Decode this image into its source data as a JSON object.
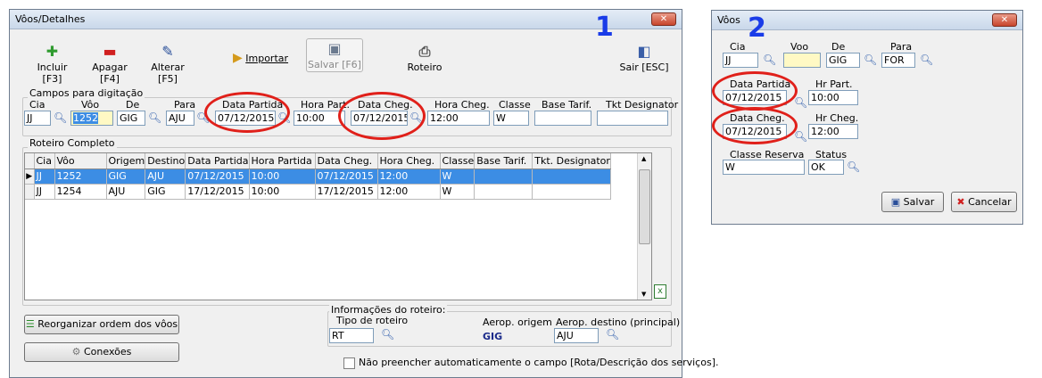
{
  "win1": {
    "title": "Vôos/Detalhes",
    "badge": "1",
    "toolbar": {
      "include": "Incluir [F3]",
      "delete": "Apagar [F4]",
      "edit": "Alterar [F5]",
      "import": "Importar",
      "save": "Salvar [F6]",
      "route": "Roteiro",
      "exit": "Sair [ESC]"
    },
    "fields_group": "Campos para digitação",
    "fields": {
      "cia": {
        "label": "Cia",
        "value": "JJ"
      },
      "voo": {
        "label": "Vôo",
        "value": "1252"
      },
      "de": {
        "label": "De",
        "value": "GIG"
      },
      "para": {
        "label": "Para",
        "value": "AJU"
      },
      "data_partida": {
        "label": "Data Partida",
        "value": "07/12/2015"
      },
      "hora_partida": {
        "label": "Hora Part.",
        "value": "10:00"
      },
      "data_cheg": {
        "label": "Data Cheg.",
        "value": "07/12/2015"
      },
      "hora_cheg": {
        "label": "Hora Cheg.",
        "value": "12:00"
      },
      "classe": {
        "label": "Classe",
        "value": "W"
      },
      "base_tarif": {
        "label": "Base Tarif.",
        "value": ""
      },
      "tkt": {
        "label": "Tkt Designator",
        "value": ""
      }
    },
    "grid_group": "Roteiro Completo",
    "grid": {
      "headers": [
        "Cia",
        "Vôo",
        "Origem",
        "Destino",
        "Data Partida",
        "Hora Partida",
        "Data Cheg.",
        "Hora Cheg.",
        "Classe",
        "Base Tarif.",
        "Tkt. Designator"
      ],
      "rows": [
        [
          "JJ",
          "1252",
          "GIG",
          "AJU",
          "07/12/2015",
          "10:00",
          "07/12/2015",
          "12:00",
          "W",
          "",
          ""
        ],
        [
          "JJ",
          "1254",
          "AJU",
          "GIG",
          "17/12/2015",
          "10:00",
          "17/12/2015",
          "12:00",
          "W",
          "",
          ""
        ]
      ]
    },
    "reorganize": "Reorganizar ordem dos vôos",
    "connections": "Conexões",
    "info_group": "Informações do roteiro:",
    "tipo_roteiro_label": "Tipo de roteiro",
    "tipo_roteiro_value": "RT",
    "aerop_origem_label": "Aerop. origem",
    "aerop_origem_value": "GIG",
    "aerop_destino_label": "Aerop. destino (principal)",
    "aerop_destino_value": "AJU",
    "checkbox_label": "Não preencher automaticamente o campo [Rota/Descrição dos serviços]."
  },
  "win2": {
    "title": "Vôos",
    "badge": "2",
    "cia": {
      "label": "Cia",
      "value": "JJ"
    },
    "voo": {
      "label": "Voo",
      "value": ""
    },
    "de": {
      "label": "De",
      "value": "GIG"
    },
    "para": {
      "label": "Para",
      "value": "FOR"
    },
    "data_partida": {
      "label": "Data Partida",
      "value": "07/12/2015"
    },
    "hr_part": {
      "label": "Hr Part.",
      "value": "10:00"
    },
    "data_cheg": {
      "label": "Data Cheg.",
      "value": "07/12/2015"
    },
    "hr_cheg": {
      "label": "Hr Cheg.",
      "value": "12:00"
    },
    "classe_reserva": {
      "label": "Classe Reserva",
      "value": "W"
    },
    "status": {
      "label": "Status",
      "value": "OK"
    },
    "save": "Salvar",
    "cancel": "Cancelar"
  }
}
